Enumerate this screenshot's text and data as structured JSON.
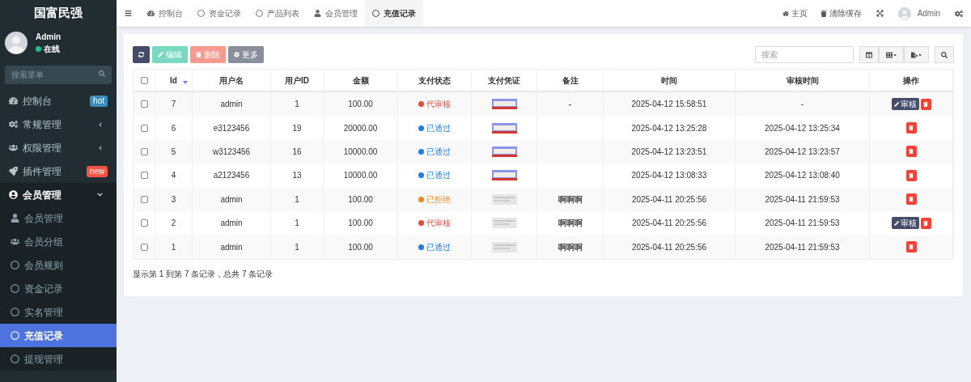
{
  "sidebar": {
    "logo": "国富民强",
    "user": {
      "name": "Admin",
      "status": "在线",
      "online": true
    },
    "search": {
      "placeholder": "搜索菜单"
    },
    "items": [
      {
        "label": "控制台",
        "badge": {
          "text": "hot",
          "color": "#3c8dbc"
        },
        "selected": false
      },
      {
        "label": "常规管理",
        "expanded": false,
        "selected": false
      },
      {
        "label": "权限管理",
        "expanded": false,
        "selected": false
      },
      {
        "label": "插件管理",
        "badge": {
          "text": "new",
          "color": "#f75444"
        },
        "selected": false
      },
      {
        "label": "会员管理",
        "expanded": true,
        "selected": false,
        "children": [
          {
            "label": "会员管理",
            "selected": false
          },
          {
            "label": "会员分组",
            "selected": false
          },
          {
            "label": "会员规则",
            "selected": false
          },
          {
            "label": "资金记录",
            "selected": false
          },
          {
            "label": "实名管理",
            "selected": false
          },
          {
            "label": "充值记录",
            "selected": true
          },
          {
            "label": "提现管理",
            "selected": false
          }
        ]
      }
    ]
  },
  "topbar": {
    "tabs": [
      {
        "label": "控制台",
        "selected": false
      },
      {
        "label": "资金记录",
        "selected": false
      },
      {
        "label": "产品列表",
        "selected": false
      },
      {
        "label": "会员管理",
        "selected": false
      },
      {
        "label": "充值记录",
        "selected": true
      }
    ],
    "right": [
      {
        "label": "主页"
      },
      {
        "label": "清除缓存"
      }
    ],
    "user": "Admin"
  },
  "toolbar": {
    "buttons": [
      {
        "kind": "refresh"
      },
      {
        "kind": "edit",
        "label": "编辑"
      },
      {
        "kind": "delete",
        "label": "删除"
      },
      {
        "kind": "more",
        "label": "更多"
      }
    ],
    "search": {
      "placeholder": "搜索"
    }
  },
  "table": {
    "select_all_checked": false,
    "columns": [
      {
        "label": "Id",
        "sorted": true
      },
      {
        "label": "用户名"
      },
      {
        "label": "用户ID"
      },
      {
        "label": "金额"
      },
      {
        "label": "支付状态"
      },
      {
        "label": "支付凭证"
      },
      {
        "label": "备注"
      },
      {
        "label": "时间"
      },
      {
        "label": "审核时间"
      },
      {
        "label": "操作"
      }
    ],
    "rows": [
      {
        "checked": false,
        "id": "7",
        "username": "admin",
        "user_id": "1",
        "amount": "100.00",
        "status": {
          "text": "代审核",
          "color": "#f0443a"
        },
        "voucher": {
          "kind": "banner"
        },
        "remark": "-",
        "time": "2025-04-12 15:58:51",
        "audit_time": "-",
        "review": "审核"
      },
      {
        "checked": false,
        "id": "6",
        "username": "e3123456",
        "user_id": "19",
        "amount": "20000.00",
        "status": {
          "text": "已通过",
          "color": "#1f7fe6"
        },
        "voucher": {
          "kind": "banner"
        },
        "remark": "",
        "time": "2025-04-12 13:25:28",
        "audit_time": "2025-04-12 13:25:34"
      },
      {
        "checked": false,
        "id": "5",
        "username": "w3123456",
        "user_id": "16",
        "amount": "10000.00",
        "status": {
          "text": "已通过",
          "color": "#1f7fe6"
        },
        "voucher": {
          "kind": "banner"
        },
        "remark": "",
        "time": "2025-04-12 13:23:51",
        "audit_time": "2025-04-12 13:23:57"
      },
      {
        "checked": false,
        "id": "4",
        "username": "a2123456",
        "user_id": "13",
        "amount": "10000.00",
        "status": {
          "text": "已通过",
          "color": "#1f7fe6"
        },
        "voucher": {
          "kind": "banner"
        },
        "remark": "",
        "time": "2025-04-12 13:08:33",
        "audit_time": "2025-04-12 13:08:40"
      },
      {
        "checked": false,
        "id": "3",
        "username": "admin",
        "user_id": "1",
        "amount": "100.00",
        "status": {
          "text": "已拒绝",
          "color": "#f7861f"
        },
        "voucher": {
          "kind": "blurred"
        },
        "remark": "啊啊啊",
        "time": "2025-04-11 20:25:56",
        "audit_time": "2025-04-11 21:59:53"
      },
      {
        "checked": false,
        "id": "2",
        "username": "admin",
        "user_id": "1",
        "amount": "100.00",
        "status": {
          "text": "代审核",
          "color": "#f0443a"
        },
        "voucher": {
          "kind": "blurred"
        },
        "remark": "啊啊啊",
        "time": "2025-04-11 20:25:56",
        "audit_time": "2025-04-11 21:59:53",
        "review": "审核"
      },
      {
        "checked": false,
        "id": "1",
        "username": "admin",
        "user_id": "1",
        "amount": "100.00",
        "status": {
          "text": "已通过",
          "color": "#1f7fe6"
        },
        "voucher": {
          "kind": "blurred"
        },
        "remark": "啊啊啊",
        "time": "2025-04-11 20:25:56",
        "audit_time": "2025-04-11 21:59:53"
      }
    ]
  },
  "pagination": {
    "summary": "显示第 1 到第 7 条记录，总共 7 条记录"
  }
}
